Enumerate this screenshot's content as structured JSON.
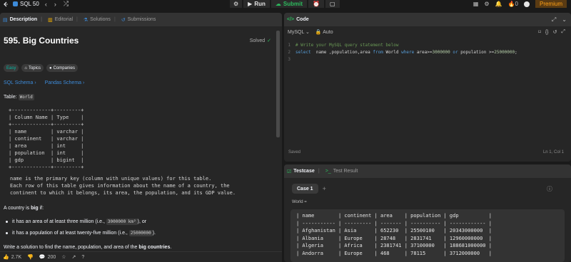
{
  "topbar": {
    "problem_list": "SQL 50",
    "run": "Run",
    "submit": "Submit",
    "streak": "0",
    "premium": "Premium"
  },
  "left": {
    "tabs": [
      {
        "label": "Description"
      },
      {
        "label": "Editorial"
      },
      {
        "label": "Solutions"
      },
      {
        "label": "Submissions"
      }
    ],
    "title": "595. Big Countries",
    "solved": "Solved",
    "tags": {
      "difficulty": "Easy",
      "topics": "Topics",
      "companies": "Companies"
    },
    "schema": {
      "sql": "SQL Schema",
      "pandas": "Pandas Schema"
    },
    "table_label": "Table: ",
    "table_name": "World",
    "ascii_table": "+-------------+---------+\n| Column Name | Type    |\n+-------------+---------+\n| name        | varchar |\n| continent   | varchar |\n| area        | int     |\n| population  | int     |\n| gdp         | bigint  |\n+-------------+---------+",
    "note1": "name is the primary key (column with unique values) for this table.",
    "note2": "Each row of this table gives information about the name of a country, the\ncontinent to which it belongs, its area, the population, and its GDP value.",
    "big_intro_prefix": "A country is ",
    "big_word": "big",
    "big_intro_suffix": " if:",
    "bullet1_prefix": "it has an area of at least three million (i.e., ",
    "bullet1_code": "3000000 km²",
    "bullet1_suffix": "), or",
    "bullet2_prefix": "it has a population of at least twenty-five million (i.e., ",
    "bullet2_code": "25000000",
    "bullet2_suffix": ").",
    "task_prefix": "Write a solution to find the name, population, and area of the ",
    "task_bold": "big countries",
    "task_suffix": ".",
    "footer": {
      "likes": "2.7K",
      "comments": "200"
    }
  },
  "code": {
    "tab": "Code",
    "language": "MySQL",
    "auto": "Auto",
    "line1_no": "1",
    "line1": "# Write your MySQL query statement below",
    "line2_no": "2",
    "line2_kw1": "select",
    "line2_t1": "  name ,population,area ",
    "line2_kw2": "from",
    "line2_t2": " World ",
    "line2_kw3": "where",
    "line2_t3": " area>=",
    "line2_n1": "3000000",
    "line2_t4": " ",
    "line2_kw4": "or",
    "line2_t5": " population >=",
    "line2_n2": "25000000",
    "line2_t6": ";",
    "line3_no": "3",
    "saved": "Saved",
    "cursor": "Ln 1, Col 1"
  },
  "test": {
    "tab_testcase": "Testcase",
    "tab_result": "Test Result",
    "case": "Case 1",
    "world_label": "World =",
    "world_table": "| name        | continent | area    | population | gdp          |\n| ----------- | --------- | ------- | ---------- | ------------ |\n| Afghanistan | Asia      | 652230  | 25500100   | 20343000000  |\n| Albania     | Europe    | 28748   | 2831741    | 12960000000  |\n| Algeria     | Africa    | 2381741 | 37100000   | 188681000000 |\n| Andorra     | Europe    | 468     | 78115      | 3712000000   |"
  }
}
